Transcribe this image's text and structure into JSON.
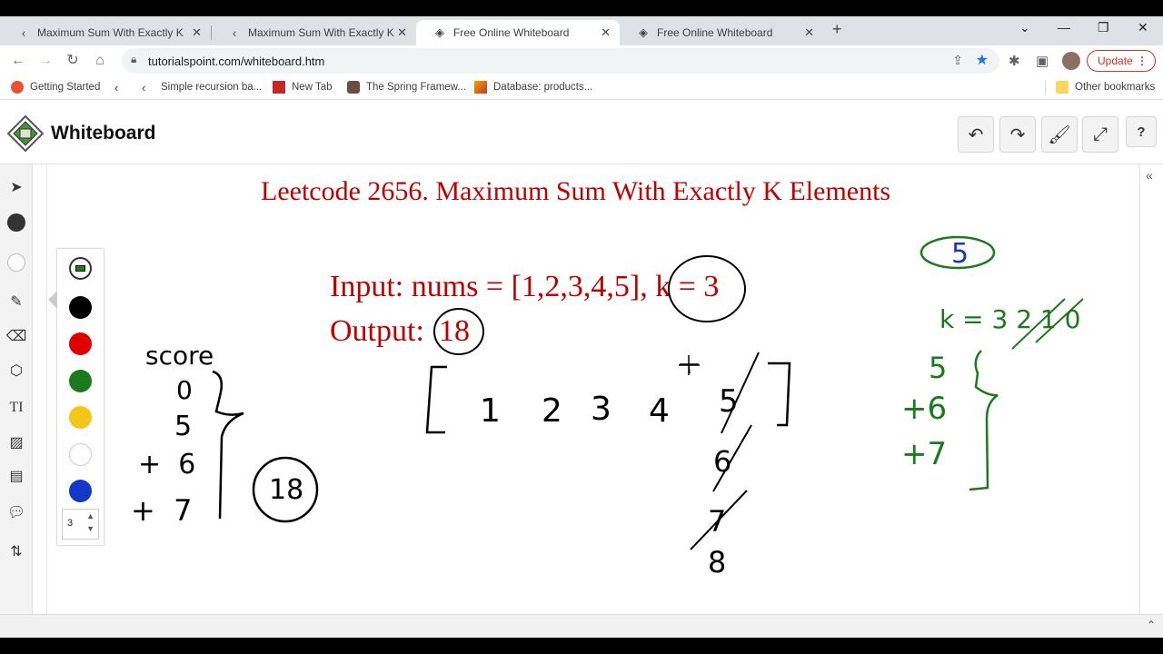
{
  "browser": {
    "tabs": [
      {
        "title": "Maximum Sum With Exactly K Ele",
        "active": false
      },
      {
        "title": "Maximum Sum With Exactly K Ele",
        "active": false
      },
      {
        "title": "Free Online Whiteboard",
        "active": true
      },
      {
        "title": "Free Online Whiteboard",
        "active": false
      }
    ],
    "url": "tutorialspoint.com/whiteboard.htm",
    "update_label": "Update",
    "bookmarks": [
      "Getting Started",
      "Simple recursion ba...",
      "New Tab",
      "The Spring Framew...",
      "Database: products..."
    ],
    "other_bookmarks": "Other bookmarks"
  },
  "app": {
    "title": "Whiteboard"
  },
  "toolbar": {
    "stroke_size": "3",
    "colors": [
      "#000000",
      "#e00000",
      "#1b7a1b",
      "#f5c518",
      "#ffffff",
      "#1238c8"
    ],
    "selected_fill": "#1b7a1b"
  },
  "board": {
    "heading": "Leetcode  2656. Maximum Sum With Exactly K Elements",
    "input_line": "Input: nums = [1,2,3,4,5], k = 3",
    "output_label": "Output:",
    "output_value": "18",
    "score_label": "score",
    "score_steps": [
      "0",
      "5",
      "+  6",
      "+  7"
    ],
    "score_total": "18",
    "array_values": [
      "1",
      "2",
      "3",
      "4",
      "5"
    ],
    "array_updates": [
      "6",
      "7",
      "8"
    ],
    "answer": "5",
    "k_line": "k = 3 2 1 0",
    "k_steps": [
      "5",
      "+6",
      "+7"
    ]
  }
}
